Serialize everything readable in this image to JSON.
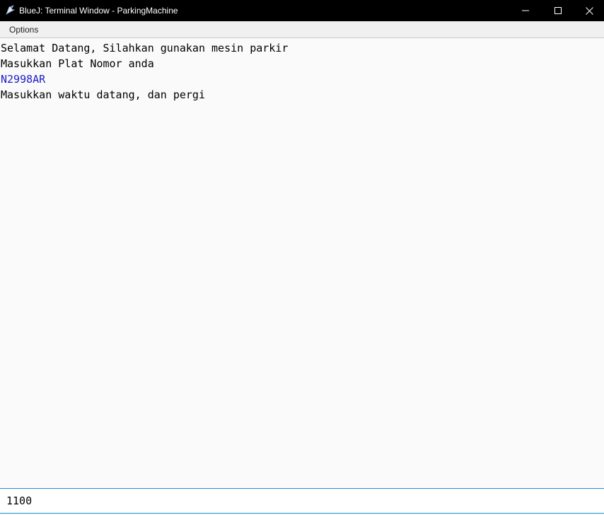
{
  "window": {
    "title": "BlueJ: Terminal Window - ParkingMachine",
    "icon": "bluej-bird-icon",
    "controls": [
      "minimize-icon",
      "maximize-icon",
      "close-icon"
    ]
  },
  "menubar": {
    "options_label": "Options"
  },
  "terminal": {
    "lines": [
      {
        "text": "Selamat Datang, Silahkan gunakan mesin parkir",
        "kind": "output"
      },
      {
        "text": "Masukkan Plat Nomor anda",
        "kind": "output"
      },
      {
        "text": "N2998AR",
        "kind": "input-echo"
      },
      {
        "text": "Masukkan waktu datang, dan pergi",
        "kind": "output"
      }
    ]
  },
  "input": {
    "value": "1100"
  },
  "colors": {
    "titlebar_bg": "#000000",
    "terminal_bg": "#fafafa",
    "input_echo": "#1c1cc8",
    "input_focus_border": "#1e90d8"
  }
}
